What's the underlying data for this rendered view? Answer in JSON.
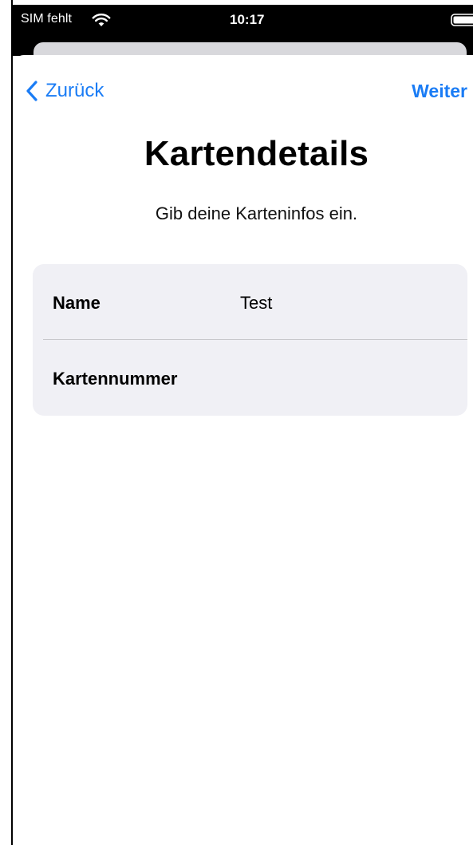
{
  "status_bar": {
    "carrier": "SIM fehlt",
    "time": "10:17",
    "icons": [
      "wifi-icon",
      "battery-icon"
    ]
  },
  "nav": {
    "back_label": "Zurück",
    "next_label": "Weiter",
    "accent_color": "#1a7cf5"
  },
  "header": {
    "title": "Kartendetails",
    "subtitle": "Gib deine Karteninfos ein."
  },
  "form": {
    "fields": [
      {
        "label": "Name",
        "value": "Test"
      },
      {
        "label": "Kartennummer",
        "value": ""
      }
    ],
    "background": "#f0f0f5"
  }
}
